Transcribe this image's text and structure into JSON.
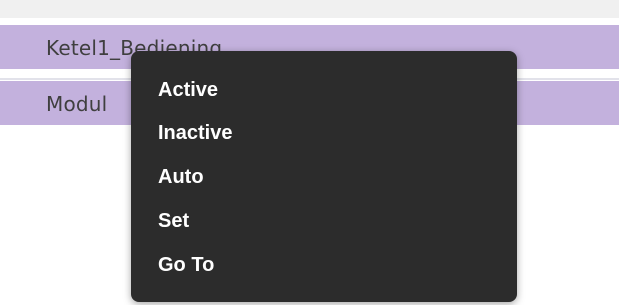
{
  "rows": [
    {
      "label": "Ketel1_Bediening"
    },
    {
      "label": "Modul"
    }
  ],
  "context_menu": {
    "items": [
      {
        "label": "Active"
      },
      {
        "label": "Inactive"
      },
      {
        "label": "Auto"
      },
      {
        "label": "Set"
      },
      {
        "label": "Go To"
      }
    ]
  },
  "colors": {
    "row_background": "#c3b1dd",
    "menu_background": "#2c2c2c",
    "menu_text": "#ffffff",
    "row_text": "#3f3f3f"
  }
}
